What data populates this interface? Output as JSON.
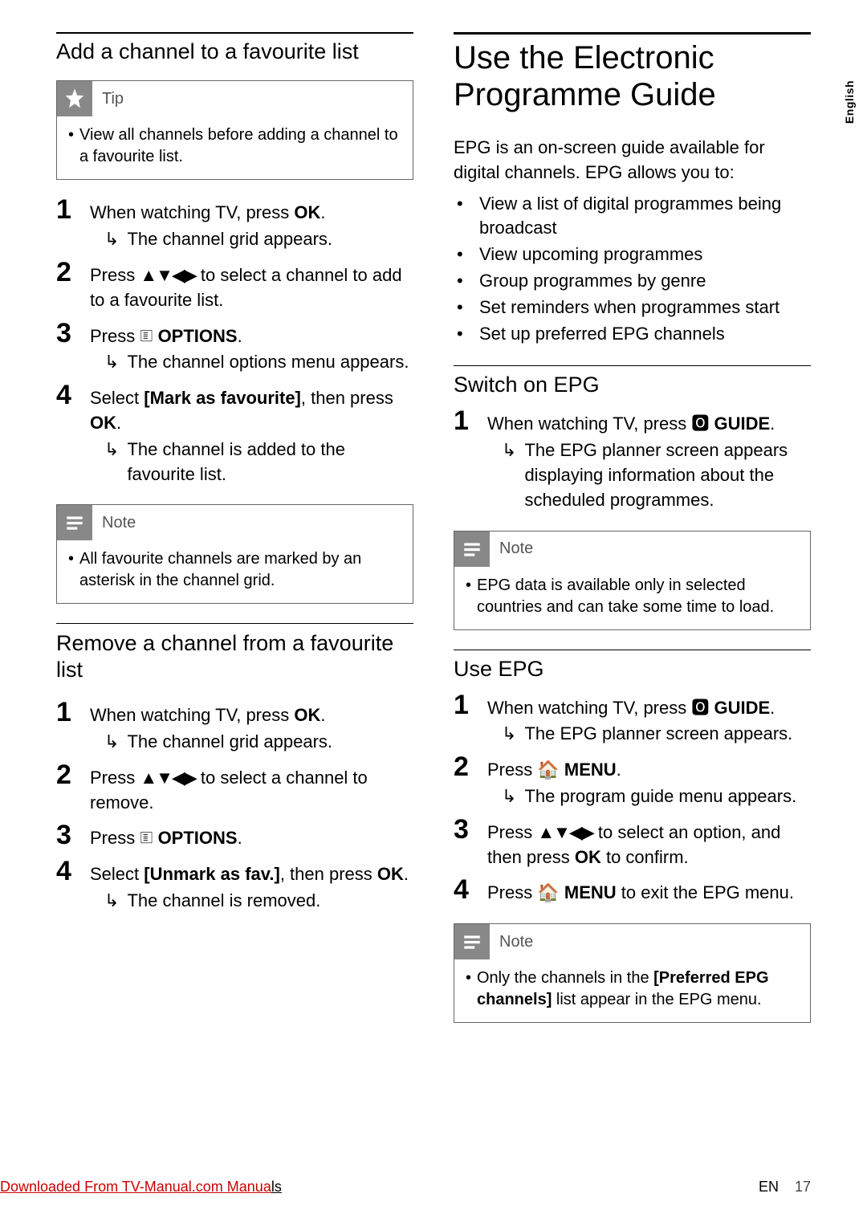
{
  "sideTab": "English",
  "left": {
    "section1": {
      "heading": "Add a channel to a favourite list",
      "tip": {
        "title": "Tip",
        "items": [
          "View all channels before adding a channel to a favourite list."
        ]
      },
      "steps": [
        {
          "num": "1",
          "text_a": "When watching TV, press ",
          "bold_a": "OK",
          "text_b": ".",
          "result": "The channel grid appears."
        },
        {
          "num": "2",
          "text_a": "Press ",
          "glyph": "▲▼◀▶",
          "text_b": " to select a channel to add to a favourite list."
        },
        {
          "num": "3",
          "text_a": "Press ",
          "icon": "options",
          "bold_a": " OPTIONS",
          "text_b": ".",
          "result": "The channel options menu appears."
        },
        {
          "num": "4",
          "text_a": "Select ",
          "bold_a": "[Mark as favourite]",
          "text_b": ", then press ",
          "bold_b": "OK",
          "text_c": ".",
          "result": "The channel is added to the favourite list."
        }
      ],
      "note": {
        "title": "Note",
        "items": [
          "All favourite channels are marked by an asterisk in the channel grid."
        ]
      }
    },
    "section2": {
      "heading": "Remove a channel from a favourite list",
      "steps": [
        {
          "num": "1",
          "text_a": "When watching TV, press ",
          "bold_a": "OK",
          "text_b": ".",
          "result": "The channel grid appears."
        },
        {
          "num": "2",
          "text_a": "Press ",
          "glyph": "▲▼◀▶",
          "text_b": " to select a channel to remove."
        },
        {
          "num": "3",
          "text_a": "Press ",
          "icon": "options",
          "bold_a": " OPTIONS",
          "text_b": "."
        },
        {
          "num": "4",
          "text_a": "Select ",
          "bold_a": "[Unmark as fav.]",
          "text_b": ", then press ",
          "bold_b": "OK",
          "text_c": ".",
          "result": "The channel is removed."
        }
      ]
    }
  },
  "right": {
    "bigHeading": "Use the Electronic Programme Guide",
    "intro": "EPG is an on-screen guide available for digital channels. EPG allows you to:",
    "introBullets": [
      "View a list of digital programmes being broadcast",
      "View upcoming programmes",
      "Group programmes by genre",
      "Set reminders when programmes start",
      "Set up preferred EPG channels"
    ],
    "section1": {
      "heading": "Switch on EPG",
      "steps": [
        {
          "num": "1",
          "text_a": "When watching TV, press ",
          "icon": "guide",
          "bold_a": " GUIDE",
          "text_b": ".",
          "result": "The EPG planner screen appears displaying information about the scheduled programmes."
        }
      ],
      "note": {
        "title": "Note",
        "items": [
          "EPG data is available only in selected countries and can take some time to load."
        ]
      }
    },
    "section2": {
      "heading": "Use EPG",
      "steps": [
        {
          "num": "1",
          "text_a": "When watching TV, press ",
          "icon": "guide",
          "bold_a": " GUIDE",
          "text_b": ".",
          "result": "The EPG planner screen appears."
        },
        {
          "num": "2",
          "text_a": " Press ",
          "icon": "home",
          "bold_a": " MENU",
          "text_b": ".",
          "result": "The program guide menu appears."
        },
        {
          "num": "3",
          "text_a": "Press ",
          "glyph": "▲▼◀▶",
          "text_b": " to select an option, and then press ",
          "bold_b": "OK",
          "text_c": " to confirm."
        },
        {
          "num": "4",
          "text_a": "Press ",
          "icon": "home",
          "bold_a": " MENU",
          "text_b": " to exit the EPG menu."
        }
      ],
      "note": {
        "title": "Note",
        "item_a": "Only the channels in the ",
        "item_bold": "[Preferred EPG channels]",
        "item_b": " list appear in the EPG menu."
      }
    }
  },
  "footer": {
    "lang": "EN",
    "page": "17",
    "download_a": "Downloaded From TV-Manual.com Manua",
    "download_b": "ls"
  }
}
